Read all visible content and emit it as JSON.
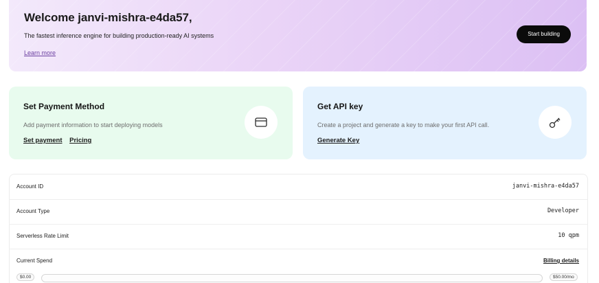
{
  "hero": {
    "title": "Welcome janvi-mishra-e4da57,",
    "subtitle": "The fastest inference engine for building production-ready AI systems",
    "learn_more": "Learn more",
    "start_button": "Start building"
  },
  "cards": {
    "payment": {
      "title": "Set Payment Method",
      "description": "Add payment information to start deploying models",
      "link_set_payment": "Set payment",
      "link_pricing": "Pricing",
      "icon": "credit-card-icon"
    },
    "api": {
      "title": "Get API key",
      "description": "Create a project and generate a key to make your first API call.",
      "link_generate": "Generate Key",
      "icon": "key-icon"
    }
  },
  "account": {
    "rows": [
      {
        "label": "Account ID",
        "value": "janvi-mishra-e4da57"
      },
      {
        "label": "Account Type",
        "value": "Developer"
      },
      {
        "label": "Serverless Rate Limit",
        "value": "10 qpm"
      }
    ],
    "spend": {
      "label": "Current Spend",
      "billing_link": "Billing details",
      "min": "$0.00",
      "max": "$50.00/mo",
      "progress_fraction": 0.0
    }
  },
  "colors": {
    "accent": "#6b3fa0",
    "payment_card_bg": "#e8fbee",
    "api_card_bg": "#e4f2fe",
    "button_bg": "#0b0b0b"
  }
}
